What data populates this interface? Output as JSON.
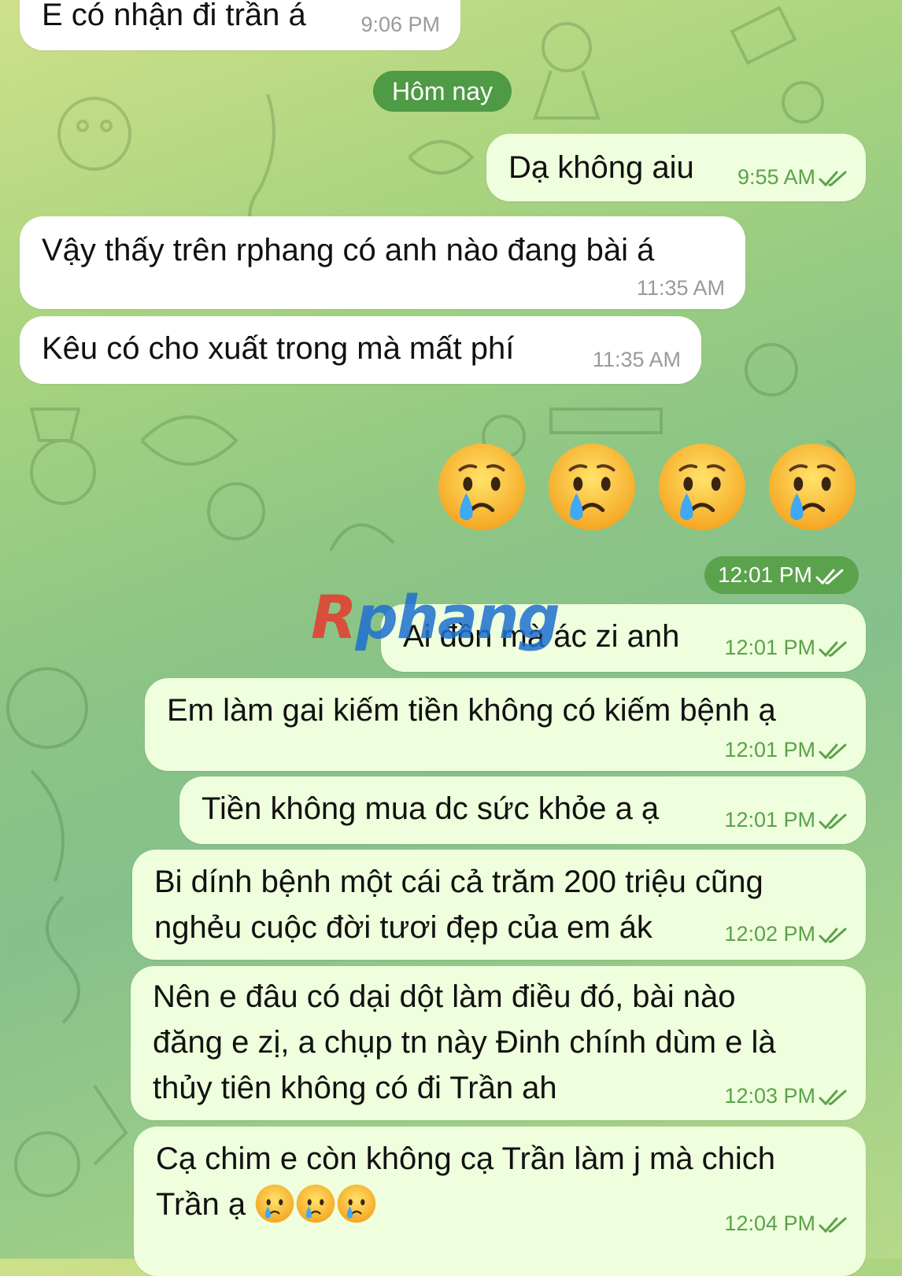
{
  "date_separator": "Hôm nay",
  "watermark": {
    "first_letter": "R",
    "rest": "phang"
  },
  "colors": {
    "incoming_bubble": "#ffffff",
    "outgoing_bubble": "#effedd",
    "time_outgoing": "#5aa24b",
    "date_pill": "#4f9a45"
  },
  "messages": [
    {
      "direction": "in",
      "text": "E có nhận đi trần á",
      "time": "9:06 PM"
    },
    {
      "direction": "out",
      "text": "Dạ không aiu",
      "time": "9:55 AM",
      "status": "read-double-check"
    },
    {
      "direction": "in",
      "text": "Vậy thấy trên rphang có anh nào đang bài á",
      "time": "11:35 AM"
    },
    {
      "direction": "in",
      "text": "Kêu có cho xuất trong mà mất phí",
      "time": "11:35 AM"
    },
    {
      "direction": "out",
      "type": "emoji",
      "emojis": [
        "crying-face-emoji",
        "crying-face-emoji",
        "crying-face-emoji",
        "crying-face-emoji"
      ],
      "time": "12:01 PM",
      "status": "read-double-check"
    },
    {
      "direction": "out",
      "text": "Ai đồn mà ác zi anh",
      "time": "12:01 PM",
      "status": "read-double-check"
    },
    {
      "direction": "out",
      "text": "Em làm gai kiếm tiền không có kiếm bệnh ạ",
      "time": "12:01 PM",
      "status": "read-double-check"
    },
    {
      "direction": "out",
      "text": "Tiền không mua dc sức khỏe a ạ",
      "time": "12:01 PM",
      "status": "read-double-check"
    },
    {
      "direction": "out",
      "text": "Bi dính bệnh một cái cả trăm 200 triệu cũng\nnghẻu cuộc đời tươi đẹp của em ák",
      "time": "12:02 PM",
      "status": "read-double-check"
    },
    {
      "direction": "out",
      "text": "Nên e đâu có dại dột làm điều đó, bài nào\nđăng e zị, a chụp tn này Đinh chính dùm e là\nthủy tiên không có đi Trần ah",
      "time": "12:03 PM",
      "status": "read-double-check"
    },
    {
      "direction": "out",
      "text": "Cạ chim e còn không cạ Trần làm j mà chich\nTrần ạ",
      "time": "12:04 PM",
      "status": "read-double-check",
      "trailing_emojis": [
        "crying-face-emoji",
        "crying-face-emoji",
        "crying-face-emoji"
      ]
    }
  ]
}
